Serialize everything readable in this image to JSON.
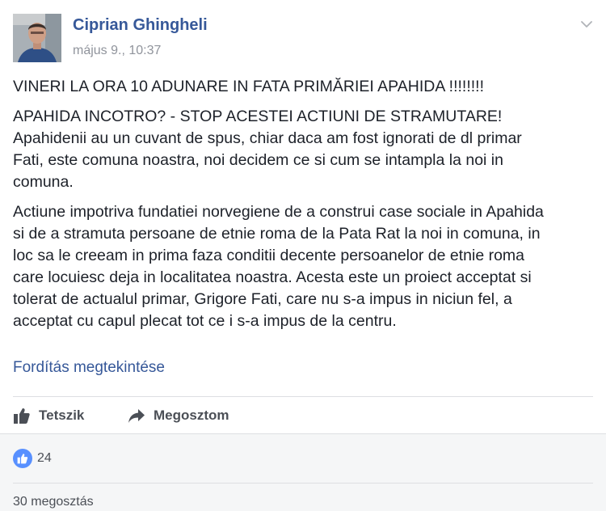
{
  "post": {
    "author": "Ciprian Ghingheli",
    "timestamp": "május 9., 10:37",
    "paragraphs": [
      "VINERI LA ORA 10 ADUNARE IN FATA PRIMĂRIEI APAHIDA !!!!!!!!",
      "APAHIDA INCOTRO? - STOP ACESTEI ACTIUNI DE STRAMUTARE!\nApahidenii au un cuvant de spus, chiar daca am fost ignorati de dl primar\nFati, este comuna noastra, noi decidem ce si cum se intampla la noi in\ncomuna.",
      "Actiune impotriva fundatiei norvegiene de a construi case sociale in Apahida\nsi de a stramuta persoane de etnie roma de la Pata Rat la noi in comuna, in\nloc sa le creeam in prima faza conditii decente persoanelor de etnie roma\ncare locuiesc deja in localitatea noastra. Acesta este un proiect acceptat si\ntolerat de actualul primar, Grigore Fati, care nu s-a impus in niciun fel, a\nacceptat cu capul plecat tot ce i s-a impus de la centru."
    ],
    "translate_link": "Fordítás megtekintése"
  },
  "actions": {
    "like_label": "Tetszik",
    "share_label": "Megosztom"
  },
  "stats": {
    "reaction_count": "24",
    "shares_label": "30 megosztás"
  },
  "icons": {
    "like": "thumbs-up-icon",
    "share": "share-arrow-icon",
    "menu": "chevron-down-icon",
    "reaction": "like-reaction-icon"
  },
  "colors": {
    "link": "#365899",
    "text": "#1d2129",
    "muted": "#90949c",
    "like_badge": "#5890ff"
  }
}
